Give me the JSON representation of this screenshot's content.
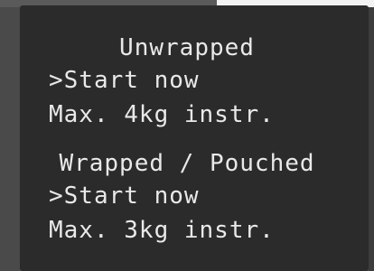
{
  "display": {
    "sections": [
      {
        "heading": "Unwrapped",
        "action": ">Start now",
        "limit": "Max. 4kg instr."
      },
      {
        "heading": "Wrapped / Pouched",
        "action": ">Start now",
        "limit": "Max. 3kg instr."
      }
    ]
  }
}
